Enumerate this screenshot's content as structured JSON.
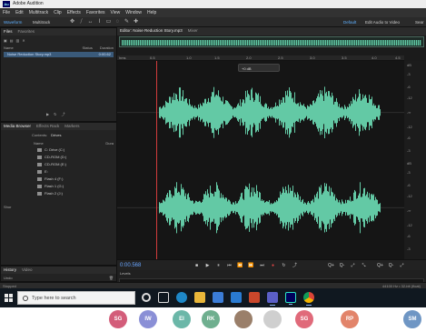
{
  "window": {
    "title": "Adobe Audition"
  },
  "menubar": [
    "File",
    "Edit",
    "Multitrack",
    "Clip",
    "Effects",
    "Favorites",
    "View",
    "Window",
    "Help"
  ],
  "toolbar": {
    "waveform_label": "Waveform",
    "multitrack_label": "Multitrack",
    "workspace_label": "Default",
    "edit_video_label": "Edit Audio to Video",
    "search_label": "Sear"
  },
  "files_panel": {
    "tabs": [
      "Files",
      "Favorites"
    ],
    "columns": [
      "Name",
      "Status",
      "Duration"
    ],
    "rows": [
      {
        "name": "Noise Reduction Story.mp3",
        "status": "",
        "duration": "0:00.62"
      }
    ]
  },
  "media_panel": {
    "tabs": [
      "Media Browser",
      "Effects Rack",
      "Markers"
    ],
    "subtabs": [
      "Contents:",
      "Drives"
    ],
    "column_name": "Name",
    "column_dur": "Dura",
    "rows": [
      "C: Drive (C:)",
      "CD-ROM (D:)",
      "CD-ROM (E:)",
      "E:",
      "Flash 4 (F:)",
      "Flash 1 (G:)",
      "Flash 2 (J:)"
    ],
    "shortcuts_label": "Shor"
  },
  "history_panel": {
    "tabs": [
      "History",
      "Video"
    ],
    "items": [
      "Undo"
    ]
  },
  "editor": {
    "tab_label": "Editor: Noise Reduction Story.mp3",
    "mixer_label": "Mixer",
    "time_display": "0:00.568",
    "hud_gain": "+0 dB",
    "ruler": [
      "hms",
      "0.5",
      "1.0",
      "1.5",
      "2.0",
      "2.5",
      "3.0",
      "3.5",
      "4.0",
      "4.5"
    ],
    "db_labels": [
      "dB",
      "-3",
      "-6",
      "-12",
      "-∞",
      "-12",
      "-6",
      "-3",
      "dB",
      "-3",
      "-6",
      "-12",
      "-∞",
      "-12",
      "-6",
      "-3"
    ],
    "levels_label": "Levels",
    "level_scale": [
      "dB",
      "-57",
      "-51",
      "-45",
      "-39",
      "-33",
      "-27",
      "-21",
      "-15",
      "-9",
      "-3",
      "0"
    ],
    "transport": [
      "■",
      "▶",
      "⏸",
      "⏮",
      "⏪",
      "⏩",
      "⏭",
      "●",
      "↻",
      "⤴"
    ],
    "zoom": [
      "Q+",
      "Q-",
      "⤢",
      "⤡",
      "Q+",
      "Q-",
      "⤢"
    ]
  },
  "status": {
    "left": "Stopped",
    "right": "44100 Hz • 32-bit (float)"
  },
  "taskbar": {
    "search_placeholder": "Type here to search",
    "apps": [
      "cortana",
      "task-view",
      "edge",
      "file-explorer",
      "store",
      "mail",
      "powerpoint",
      "teams",
      "audition",
      "chrome"
    ]
  },
  "participants": [
    {
      "initials": "SG",
      "color": "#d35d7a"
    },
    {
      "initials": "IW",
      "color": "#8a8fd6"
    },
    {
      "initials": "EI",
      "color": "#6bb7a8"
    },
    {
      "initials": "RK",
      "color": "#6faf8f"
    },
    {
      "initials": "",
      "color": "#9a7f6a"
    },
    {
      "initials": "",
      "color": "#cfcfcf"
    },
    {
      "initials": "SG",
      "color": "#e06a7a"
    },
    {
      "initials": "RP",
      "color": "#e2846a"
    },
    {
      "initials": "SM",
      "color": "#6f96c4"
    }
  ],
  "colors": {
    "waveform": "#63c9a5",
    "playhead": "#d23c3c",
    "accent": "#5fb0ff"
  }
}
